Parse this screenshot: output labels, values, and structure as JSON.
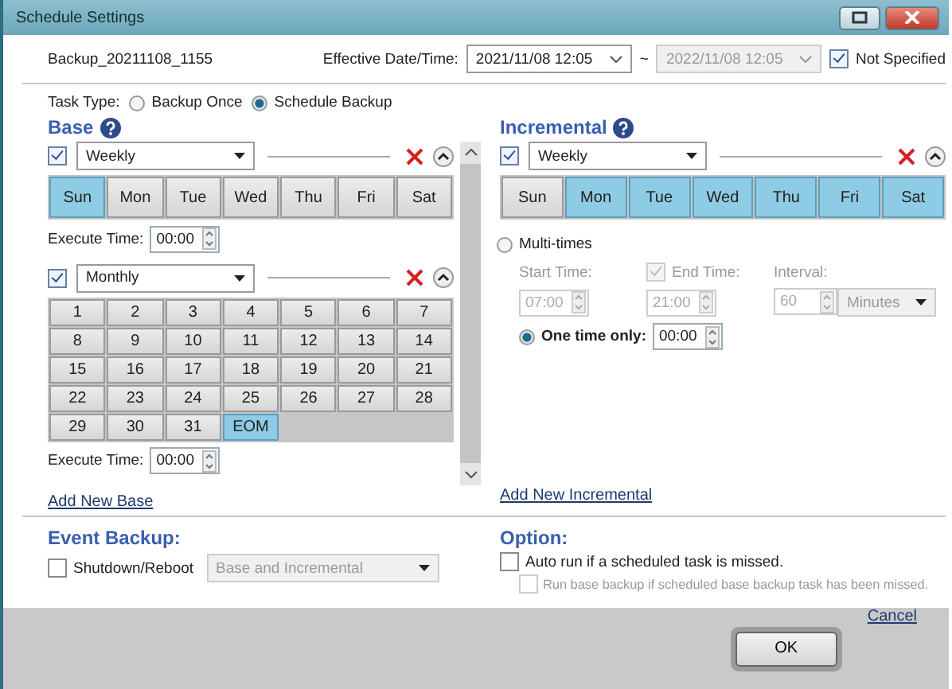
{
  "window": {
    "title": "Schedule Settings"
  },
  "task_name": "Backup_20211108_1155",
  "effective": {
    "label": "Effective Date/Time:",
    "start": "2021/11/08 12:05",
    "separator": "~",
    "end": "2022/11/08 12:05",
    "not_specified": {
      "label": "Not Specified",
      "checked": true
    }
  },
  "task_type": {
    "label": "Task Type:",
    "options": [
      {
        "label": "Backup Once",
        "selected": false
      },
      {
        "label": "Schedule Backup",
        "selected": true
      }
    ]
  },
  "base": {
    "title": "Base",
    "add_link": "Add New Base",
    "schedules": [
      {
        "kind": "weekly",
        "checked": true,
        "frequency": "Weekly",
        "days": [
          {
            "label": "Sun",
            "selected": true
          },
          {
            "label": "Mon",
            "selected": false
          },
          {
            "label": "Tue",
            "selected": false
          },
          {
            "label": "Wed",
            "selected": false
          },
          {
            "label": "Thu",
            "selected": false
          },
          {
            "label": "Fri",
            "selected": false
          },
          {
            "label": "Sat",
            "selected": false
          }
        ],
        "execute_time": {
          "label": "Execute Time:",
          "value": "00:00"
        }
      },
      {
        "kind": "monthly",
        "checked": true,
        "frequency": "Monthly",
        "days": [
          {
            "label": "1",
            "selected": false
          },
          {
            "label": "2",
            "selected": false
          },
          {
            "label": "3",
            "selected": false
          },
          {
            "label": "4",
            "selected": false
          },
          {
            "label": "5",
            "selected": false
          },
          {
            "label": "6",
            "selected": false
          },
          {
            "label": "7",
            "selected": false
          },
          {
            "label": "8",
            "selected": false
          },
          {
            "label": "9",
            "selected": false
          },
          {
            "label": "10",
            "selected": false
          },
          {
            "label": "11",
            "selected": false
          },
          {
            "label": "12",
            "selected": false
          },
          {
            "label": "13",
            "selected": false
          },
          {
            "label": "14",
            "selected": false
          },
          {
            "label": "15",
            "selected": false
          },
          {
            "label": "16",
            "selected": false
          },
          {
            "label": "17",
            "selected": false
          },
          {
            "label": "18",
            "selected": false
          },
          {
            "label": "19",
            "selected": false
          },
          {
            "label": "20",
            "selected": false
          },
          {
            "label": "21",
            "selected": false
          },
          {
            "label": "22",
            "selected": false
          },
          {
            "label": "23",
            "selected": false
          },
          {
            "label": "24",
            "selected": false
          },
          {
            "label": "25",
            "selected": false
          },
          {
            "label": "26",
            "selected": false
          },
          {
            "label": "27",
            "selected": false
          },
          {
            "label": "28",
            "selected": false
          },
          {
            "label": "29",
            "selected": false
          },
          {
            "label": "30",
            "selected": false
          },
          {
            "label": "31",
            "selected": false
          },
          {
            "label": "EOM",
            "selected": true
          }
        ],
        "execute_time": {
          "label": "Execute Time:",
          "value": "00:00"
        }
      }
    ]
  },
  "incremental": {
    "title": "Incremental",
    "add_link": "Add New Incremental",
    "schedules": [
      {
        "kind": "weekly",
        "checked": true,
        "frequency": "Weekly",
        "days": [
          {
            "label": "Sun",
            "selected": false
          },
          {
            "label": "Mon",
            "selected": true
          },
          {
            "label": "Tue",
            "selected": true
          },
          {
            "label": "Wed",
            "selected": true
          },
          {
            "label": "Thu",
            "selected": true
          },
          {
            "label": "Fri",
            "selected": true
          },
          {
            "label": "Sat",
            "selected": true
          }
        ]
      }
    ],
    "multi_times": {
      "label": "Multi-times",
      "selected": false,
      "start_time": {
        "label": "Start Time:",
        "value": "07:00"
      },
      "end_time": {
        "label": "End Time:",
        "checked": true,
        "value": "21:00"
      },
      "interval": {
        "label": "Interval:",
        "value": "60",
        "unit": "Minutes"
      }
    },
    "one_time": {
      "label": "One time only:",
      "selected": true,
      "value": "00:00"
    }
  },
  "event_backup": {
    "title": "Event Backup:",
    "shutdown": {
      "label": "Shutdown/Reboot",
      "checked": false
    },
    "mode": "Base and Incremental"
  },
  "option": {
    "title": "Option:",
    "items": [
      {
        "label": "Auto run if a scheduled task is missed.",
        "checked": false,
        "disabled": false
      },
      {
        "label": "Run base backup if scheduled base backup task has been missed.",
        "checked": false,
        "disabled": true
      }
    ]
  },
  "buttons": {
    "ok": "OK",
    "cancel": "Cancel"
  }
}
